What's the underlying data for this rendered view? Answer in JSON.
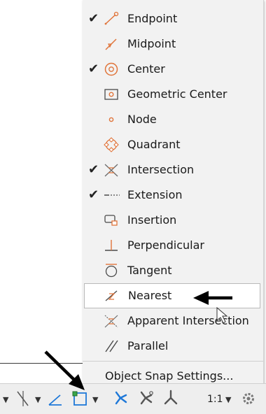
{
  "snap_menu": {
    "items": [
      {
        "label": "Endpoint",
        "checked": true,
        "icon": "endpoint-snap-icon"
      },
      {
        "label": "Midpoint",
        "checked": false,
        "icon": "midpoint-snap-icon"
      },
      {
        "label": "Center",
        "checked": true,
        "icon": "center-snap-icon"
      },
      {
        "label": "Geometric Center",
        "checked": false,
        "icon": "geometric-center-snap-icon"
      },
      {
        "label": "Node",
        "checked": false,
        "icon": "node-snap-icon"
      },
      {
        "label": "Quadrant",
        "checked": false,
        "icon": "quadrant-snap-icon"
      },
      {
        "label": "Intersection",
        "checked": true,
        "icon": "intersection-snap-icon"
      },
      {
        "label": "Extension",
        "checked": true,
        "icon": "extension-snap-icon"
      },
      {
        "label": "Insertion",
        "checked": false,
        "icon": "insertion-snap-icon"
      },
      {
        "label": "Perpendicular",
        "checked": false,
        "icon": "perpendicular-snap-icon"
      },
      {
        "label": "Tangent",
        "checked": false,
        "icon": "tangent-snap-icon"
      },
      {
        "label": "Nearest",
        "checked": false,
        "icon": "nearest-snap-icon",
        "highlighted": true
      },
      {
        "label": "Apparent Intersection",
        "checked": false,
        "icon": "apparent-intersection-snap-icon"
      },
      {
        "label": "Parallel",
        "checked": false,
        "icon": "parallel-snap-icon"
      }
    ],
    "check_mark": "✔",
    "settings_label": "Object Snap Settings..."
  },
  "statusbar": {
    "dropdown_caret": "▼",
    "scale_label": "1:1",
    "icons": [
      "polar-tracking-icon",
      "isometric-drafting-icon",
      "object-snap-tracking-icon",
      "object-snap-icon",
      "annotation-visibility-icon",
      "autoscale-icon",
      "annotation-scale-icon",
      "workspace-gear-icon"
    ]
  },
  "colors": {
    "menu_bg": "#f2f2f2",
    "icon_orange": "#e0743a",
    "icon_blue": "#1e78d8",
    "icon_green": "#3aa64a",
    "arrow": "#000000"
  }
}
